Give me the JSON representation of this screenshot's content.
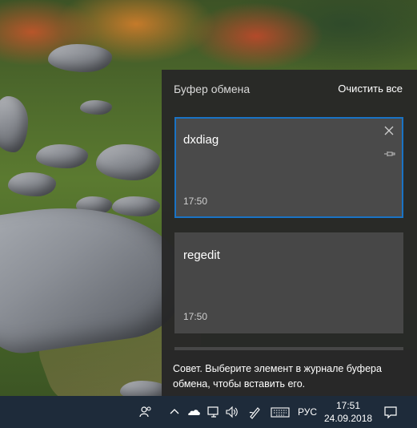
{
  "clipboard_panel": {
    "title": "Буфер обмена",
    "clear_all_label": "Очистить все",
    "items": [
      {
        "text": "dxdiag",
        "time": "17:50",
        "selected": true
      },
      {
        "text": "regedit",
        "time": "17:50",
        "selected": false
      }
    ],
    "tip": "Совет. Выберите элемент в журнале буфера обмена, чтобы вставить его."
  },
  "taskbar": {
    "tray_icons": [
      "people-icon",
      "chevron-up-icon",
      "onedrive-cloud-icon",
      "network-icon",
      "volume-icon",
      "pen-ink-icon",
      "touch-keyboard-icon"
    ],
    "language": "РУС",
    "time": "17:51",
    "date": "24.09.2018",
    "notification_icon": "action-center-icon"
  },
  "colors": {
    "panel_bg": "#282828",
    "item_bg": "#474747",
    "selected_border": "#1a73c4",
    "taskbar_bg": "#1e2b3a"
  }
}
